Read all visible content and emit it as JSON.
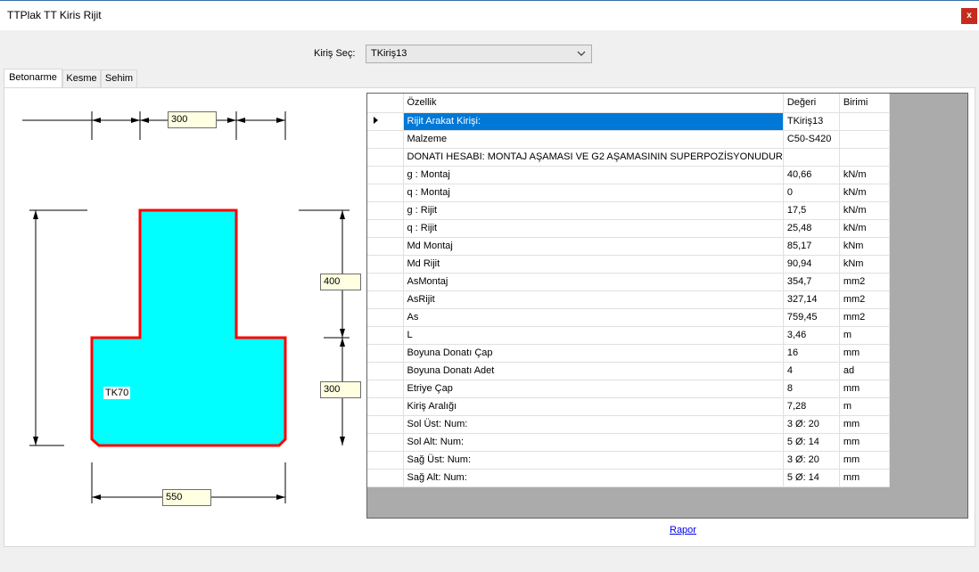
{
  "window": {
    "title": "TTPlak TT Kiris Rijit",
    "close_label": "x"
  },
  "selector": {
    "label": "Kiriş Seç:",
    "value": "TKiriş13",
    "chevron_icon": "chevron-down-icon"
  },
  "tabs": [
    {
      "label": "Betonarme",
      "active": true
    },
    {
      "label": "Kesme",
      "active": false
    },
    {
      "label": "Sehim",
      "active": false
    }
  ],
  "drawing": {
    "dims": {
      "top_width": "300",
      "web_height": "400",
      "flange_height": "300",
      "bottom_width": "550"
    },
    "section_label": "TK70",
    "fill_color": "#00ffff",
    "outline_color": "#ff0000"
  },
  "grid": {
    "headers": {
      "property": "Özellik",
      "value": "Değeri",
      "unit": "Birimi"
    },
    "rows": [
      {
        "property": "Rijit Arakat Kirişi:",
        "value": "TKiriş13",
        "unit": ""
      },
      {
        "property": "Malzeme",
        "value": "C50-S420",
        "unit": ""
      },
      {
        "property": "DONATI HESABI: MONTAJ AŞAMASI VE G2 AŞAMASININ SUPERPOZİSYONUDUR",
        "value": "",
        "unit": ""
      },
      {
        "property": "g : Montaj",
        "value": "40,66",
        "unit": "kN/m"
      },
      {
        "property": "q : Montaj",
        "value": "0",
        "unit": "kN/m"
      },
      {
        "property": "g : Rijit",
        "value": "17,5",
        "unit": "kN/m"
      },
      {
        "property": "q : Rijit",
        "value": "25,48",
        "unit": "kN/m"
      },
      {
        "property": "Md Montaj",
        "value": "85,17",
        "unit": "kNm"
      },
      {
        "property": "Md Rijit",
        "value": "90,94",
        "unit": "kNm"
      },
      {
        "property": "AsMontaj",
        "value": "354,7",
        "unit": "mm2"
      },
      {
        "property": "AsRijit",
        "value": "327,14",
        "unit": "mm2"
      },
      {
        "property": "As",
        "value": "759,45",
        "unit": "mm2"
      },
      {
        "property": "L",
        "value": "3,46",
        "unit": "m"
      },
      {
        "property": "Boyuna Donatı Çap",
        "value": "16",
        "unit": "mm"
      },
      {
        "property": "Boyuna Donatı Adet",
        "value": "4",
        "unit": "ad"
      },
      {
        "property": "Etriye Çap",
        "value": "8",
        "unit": "mm"
      },
      {
        "property": "Kiriş Aralığı",
        "value": "7,28",
        "unit": " m"
      },
      {
        "property": "Sol Üst: Num:",
        "value": "3 Ø: 20",
        "unit": "mm"
      },
      {
        "property": "Sol Alt: Num:",
        "value": "5 Ø: 14",
        "unit": "mm"
      },
      {
        "property": "Sağ Üst: Num:",
        "value": "3 Ø: 20",
        "unit": "mm"
      },
      {
        "property": "Sağ Alt: Num:",
        "value": "5 Ø: 14",
        "unit": "mm"
      }
    ],
    "selected_index": 0
  },
  "report_link": "Rapor"
}
